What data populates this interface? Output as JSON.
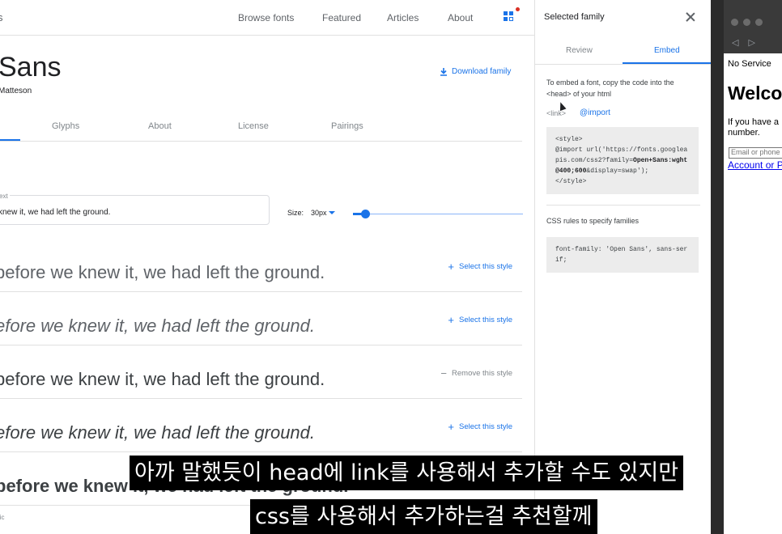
{
  "nav": {
    "logo_fragment": "s",
    "links": [
      "Browse fonts",
      "Featured",
      "Articles",
      "About"
    ],
    "grid_icon": "apps-grid-icon"
  },
  "family": {
    "title": "Sans",
    "designer": "Matteson",
    "download_label": "Download family"
  },
  "tabs": [
    "Glyphs",
    "About",
    "License",
    "Pairings"
  ],
  "preview": {
    "field_label": "ext",
    "field_value": "knew it, we had left the ground.",
    "size_label": "Size:",
    "size_value": "30px",
    "size_level": 0.08
  },
  "styles": [
    {
      "sample": "before we knew it, we had left the ground.",
      "action": "Select this style",
      "kind": "select",
      "variant": "light"
    },
    {
      "sample": "efore we knew it, we had left the ground.",
      "action": "Select this style",
      "kind": "select",
      "variant": "light-italic"
    },
    {
      "sample": "before we knew it, we had left the ground.",
      "action": "Remove this style",
      "kind": "remove",
      "variant": "regular"
    },
    {
      "sample": "efore we knew it, we had left the ground.",
      "action": "Select this style",
      "kind": "select",
      "variant": "italic"
    },
    {
      "sample": "before we knew it, we had left the ground.",
      "action": "Select this style",
      "kind": "select",
      "variant": "semibold"
    }
  ],
  "row_label_fragment": "lic",
  "panel": {
    "title": "Selected family",
    "tabs": [
      "Review",
      "Embed"
    ],
    "active_tab": "Embed",
    "intro": "To embed a font, copy the code into the <head> of your html",
    "option_link": "<link>",
    "option_import": "@import",
    "import_code_start": "<style>\n@import url('https://fonts.googleapis.com/css2?family=",
    "import_code_bold": "Open+Sans:wght@400;600",
    "import_code_end": "&display=swap');\n</style>",
    "css_rules_label": "CSS rules to specify families",
    "css_code": "font-family: 'Open Sans', sans-serif;"
  },
  "other_window": {
    "status": "No Service",
    "welcome": "Welco",
    "info": "If you have a number.",
    "email_placeholder": "Email or phone",
    "account_link": "Account or P"
  },
  "subtitles": {
    "line1": "아까 말했듯이 head에 link를 사용해서 추가할 수도 있지만",
    "line2": "css를 사용해서 추가하는걸 추천할께"
  },
  "colors": {
    "accent": "#1a73e8",
    "notification": "#d93025"
  }
}
